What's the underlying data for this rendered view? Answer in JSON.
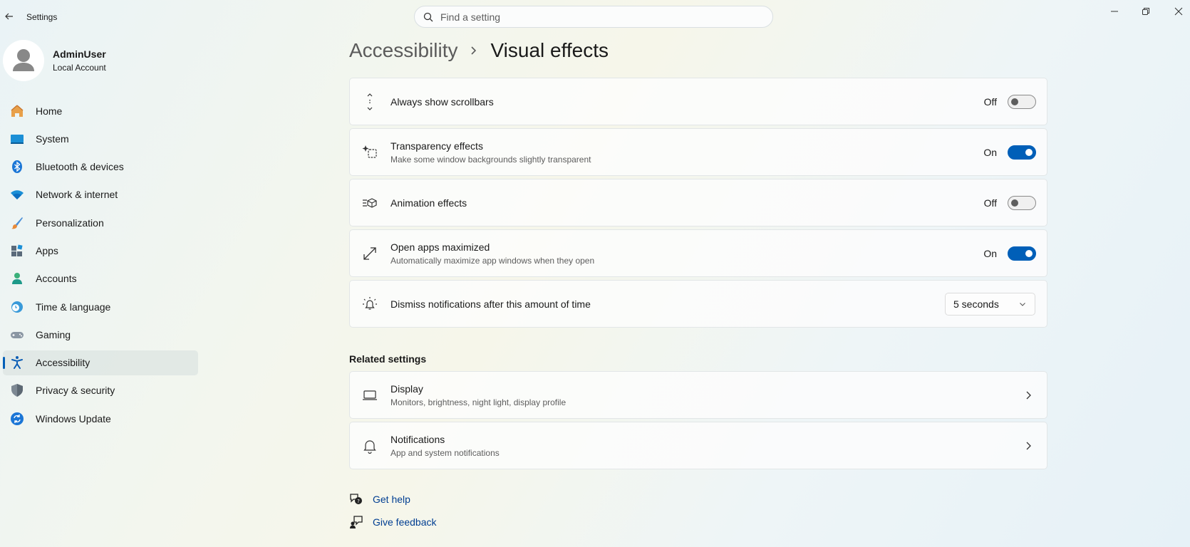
{
  "window": {
    "title": "Settings",
    "controls": [
      "minimize-icon",
      "restore-icon",
      "close-icon"
    ]
  },
  "search": {
    "placeholder": "Find a setting",
    "value": ""
  },
  "profile": {
    "name": "AdminUser",
    "account_type": "Local Account"
  },
  "sidebar": {
    "items": [
      {
        "label": "Home",
        "icon": "home-icon"
      },
      {
        "label": "System",
        "icon": "system-icon"
      },
      {
        "label": "Bluetooth & devices",
        "icon": "bluetooth-icon"
      },
      {
        "label": "Network & internet",
        "icon": "wifi-icon"
      },
      {
        "label": "Personalization",
        "icon": "brush-icon"
      },
      {
        "label": "Apps",
        "icon": "apps-icon"
      },
      {
        "label": "Accounts",
        "icon": "accounts-icon"
      },
      {
        "label": "Time & language",
        "icon": "time-language-icon"
      },
      {
        "label": "Gaming",
        "icon": "gaming-icon"
      },
      {
        "label": "Accessibility",
        "icon": "accessibility-icon",
        "active": true
      },
      {
        "label": "Privacy & security",
        "icon": "shield-icon"
      },
      {
        "label": "Windows Update",
        "icon": "update-icon"
      }
    ]
  },
  "breadcrumb": {
    "parent": "Accessibility",
    "current": "Visual effects"
  },
  "settings": [
    {
      "title": "Always show scrollbars",
      "description": "",
      "state": "Off",
      "icon": "scrollbar-icon"
    },
    {
      "title": "Transparency effects",
      "description": "Make some window backgrounds slightly transparent",
      "state": "On",
      "icon": "transparency-icon"
    },
    {
      "title": "Animation effects",
      "description": "",
      "state": "Off",
      "icon": "animation-icon"
    },
    {
      "title": "Open apps maximized",
      "description": "Automatically maximize app windows when they open",
      "state": "On",
      "icon": "maximize-icon"
    },
    {
      "title": "Dismiss notifications after this amount of time",
      "description": "",
      "value": "5 seconds",
      "icon": "notification-timer-icon"
    }
  ],
  "related": {
    "title": "Related settings",
    "items": [
      {
        "title": "Display",
        "description": "Monitors, brightness, night light, display profile",
        "icon": "display-icon"
      },
      {
        "title": "Notifications",
        "description": "App and system notifications",
        "icon": "bell-icon"
      }
    ]
  },
  "help": {
    "get_help": "Get help",
    "give_feedback": "Give feedback"
  },
  "colors": {
    "accent": "#005fb8",
    "link": "#003e92"
  }
}
